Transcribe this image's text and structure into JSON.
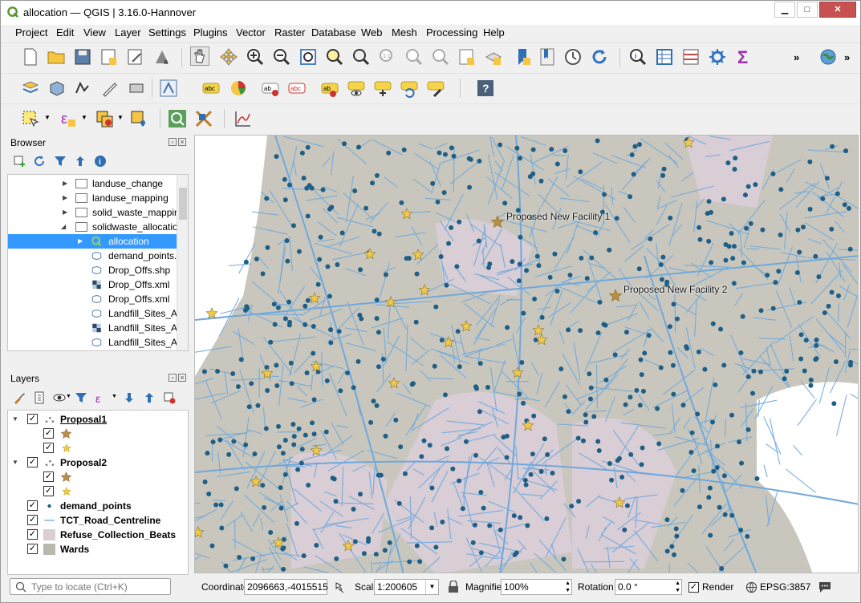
{
  "window": {
    "title": "allocation — QGIS | 3.16.0-Hannover"
  },
  "menu": [
    "Project",
    "Edit",
    "View",
    "Layer",
    "Settings",
    "Plugins",
    "Vector",
    "Raster",
    "Database",
    "Web",
    "Mesh",
    "Processing",
    "Help"
  ],
  "toolbar": {
    "more": "»"
  },
  "browser": {
    "title": "Browser",
    "items": [
      {
        "label": "landuse_change"
      },
      {
        "label": "landuse_mapping"
      },
      {
        "label": "solid_waste_mappin"
      },
      {
        "label": "solidwaste_allocatio"
      },
      {
        "label": "allocation"
      },
      {
        "label": "demand_points."
      },
      {
        "label": "Drop_Offs.shp"
      },
      {
        "label": "Drop_Offs.xml"
      },
      {
        "label": "Drop_Offs.xml"
      },
      {
        "label": "Landfill_Sites_Ar"
      },
      {
        "label": "Landfill_Sites_Ar"
      },
      {
        "label": "Landfill_Sites_Ar"
      }
    ]
  },
  "layers": {
    "title": "Layers",
    "items": [
      {
        "label": "Proposal1"
      },
      {
        "label": "Proposal2"
      },
      {
        "label": "demand_points"
      },
      {
        "label": "TCT_Road_Centreline"
      },
      {
        "label": "Refuse_Collection_Beats"
      },
      {
        "label": "Wards"
      }
    ]
  },
  "map": {
    "labels": [
      "Proposed New Facility 1",
      "Proposed New Facility 2"
    ],
    "colors": {
      "land": "#c9c7bd",
      "wards": "#d9cdd6",
      "roads": "#6fa8dc",
      "points": "#1f5f86",
      "star": "#f0c94a",
      "proposed_star": "#b98d4a"
    }
  },
  "status": {
    "search_placeholder": "Type to locate (Ctrl+K)",
    "coordinate_label": "Coordinate",
    "coordinate_value": "2096663,-4015515",
    "scale_label": "Scale",
    "scale_value": "1:200605",
    "magnifier_label": "Magnifier",
    "magnifier_value": "100%",
    "rotation_label": "Rotation",
    "rotation_value": "0.0 °",
    "render_label": "Render",
    "crs": "EPSG:3857"
  }
}
